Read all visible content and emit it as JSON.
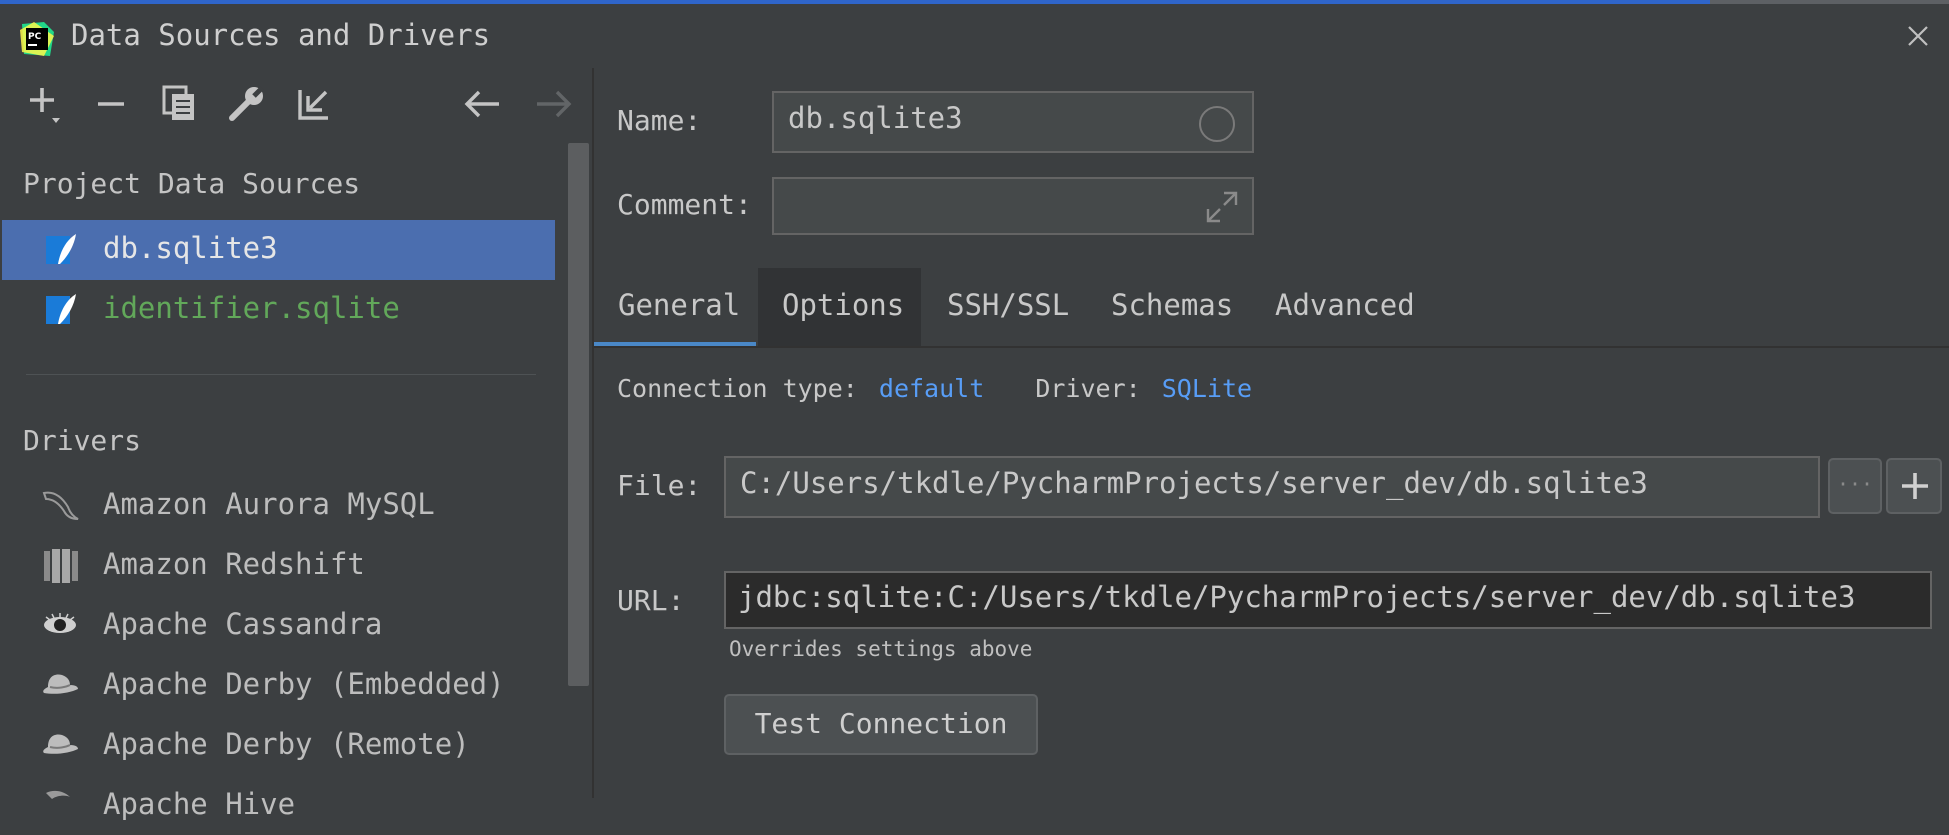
{
  "window": {
    "title": "Data Sources and Drivers",
    "app_logo_text": "PC"
  },
  "toolbar": {
    "items": [
      "add-icon",
      "remove-icon",
      "duplicate-icon",
      "wrench-icon",
      "import-icon",
      "back-arrow-icon",
      "forward-arrow-icon"
    ]
  },
  "sidebar": {
    "project_title": "Project Data Sources",
    "data_sources": [
      {
        "label": "db.sqlite3",
        "icon": "sqlite-icon",
        "selected": true
      },
      {
        "label": "identifier.sqlite",
        "icon": "sqlite-icon",
        "selected": false
      }
    ],
    "drivers_title": "Drivers",
    "drivers": [
      {
        "label": "Amazon Aurora MySQL",
        "icon": "dolphin-icon"
      },
      {
        "label": "Amazon Redshift",
        "icon": "redshift-icon"
      },
      {
        "label": "Apache Cassandra",
        "icon": "eye-icon"
      },
      {
        "label": "Apache Derby (Embedded)",
        "icon": "hat-icon"
      },
      {
        "label": "Apache Derby (Remote)",
        "icon": "hat-icon"
      },
      {
        "label": "Apache Hive",
        "icon": "hive-icon"
      }
    ]
  },
  "form": {
    "name_label": "Name:",
    "name_value": "db.sqlite3",
    "comment_label": "Comment:",
    "comment_value": "",
    "tabs": [
      "General",
      "Options",
      "SSH/SSL",
      "Schemas",
      "Advanced"
    ],
    "active_tab": "General",
    "connection_type_label": "Connection type:",
    "connection_type_value": "default",
    "driver_label": "Driver:",
    "driver_value": "SQLite",
    "file_label": "File:",
    "file_value": "C:/Users/tkdle/PycharmProjects/server_dev/db.sqlite3",
    "browse_label": "···",
    "url_label": "URL:",
    "url_value": "jdbc:sqlite:C:/Users/tkdle/PycharmProjects/server_dev/db.sqlite3",
    "url_note": "Overrides settings above",
    "test_connection_label": "Test Connection"
  },
  "colors": {
    "background": "#3c3f41",
    "selection": "#4b6eaf",
    "link": "#589df6",
    "green_text": "#62a85a",
    "tab_underline": "#4a88c7"
  }
}
